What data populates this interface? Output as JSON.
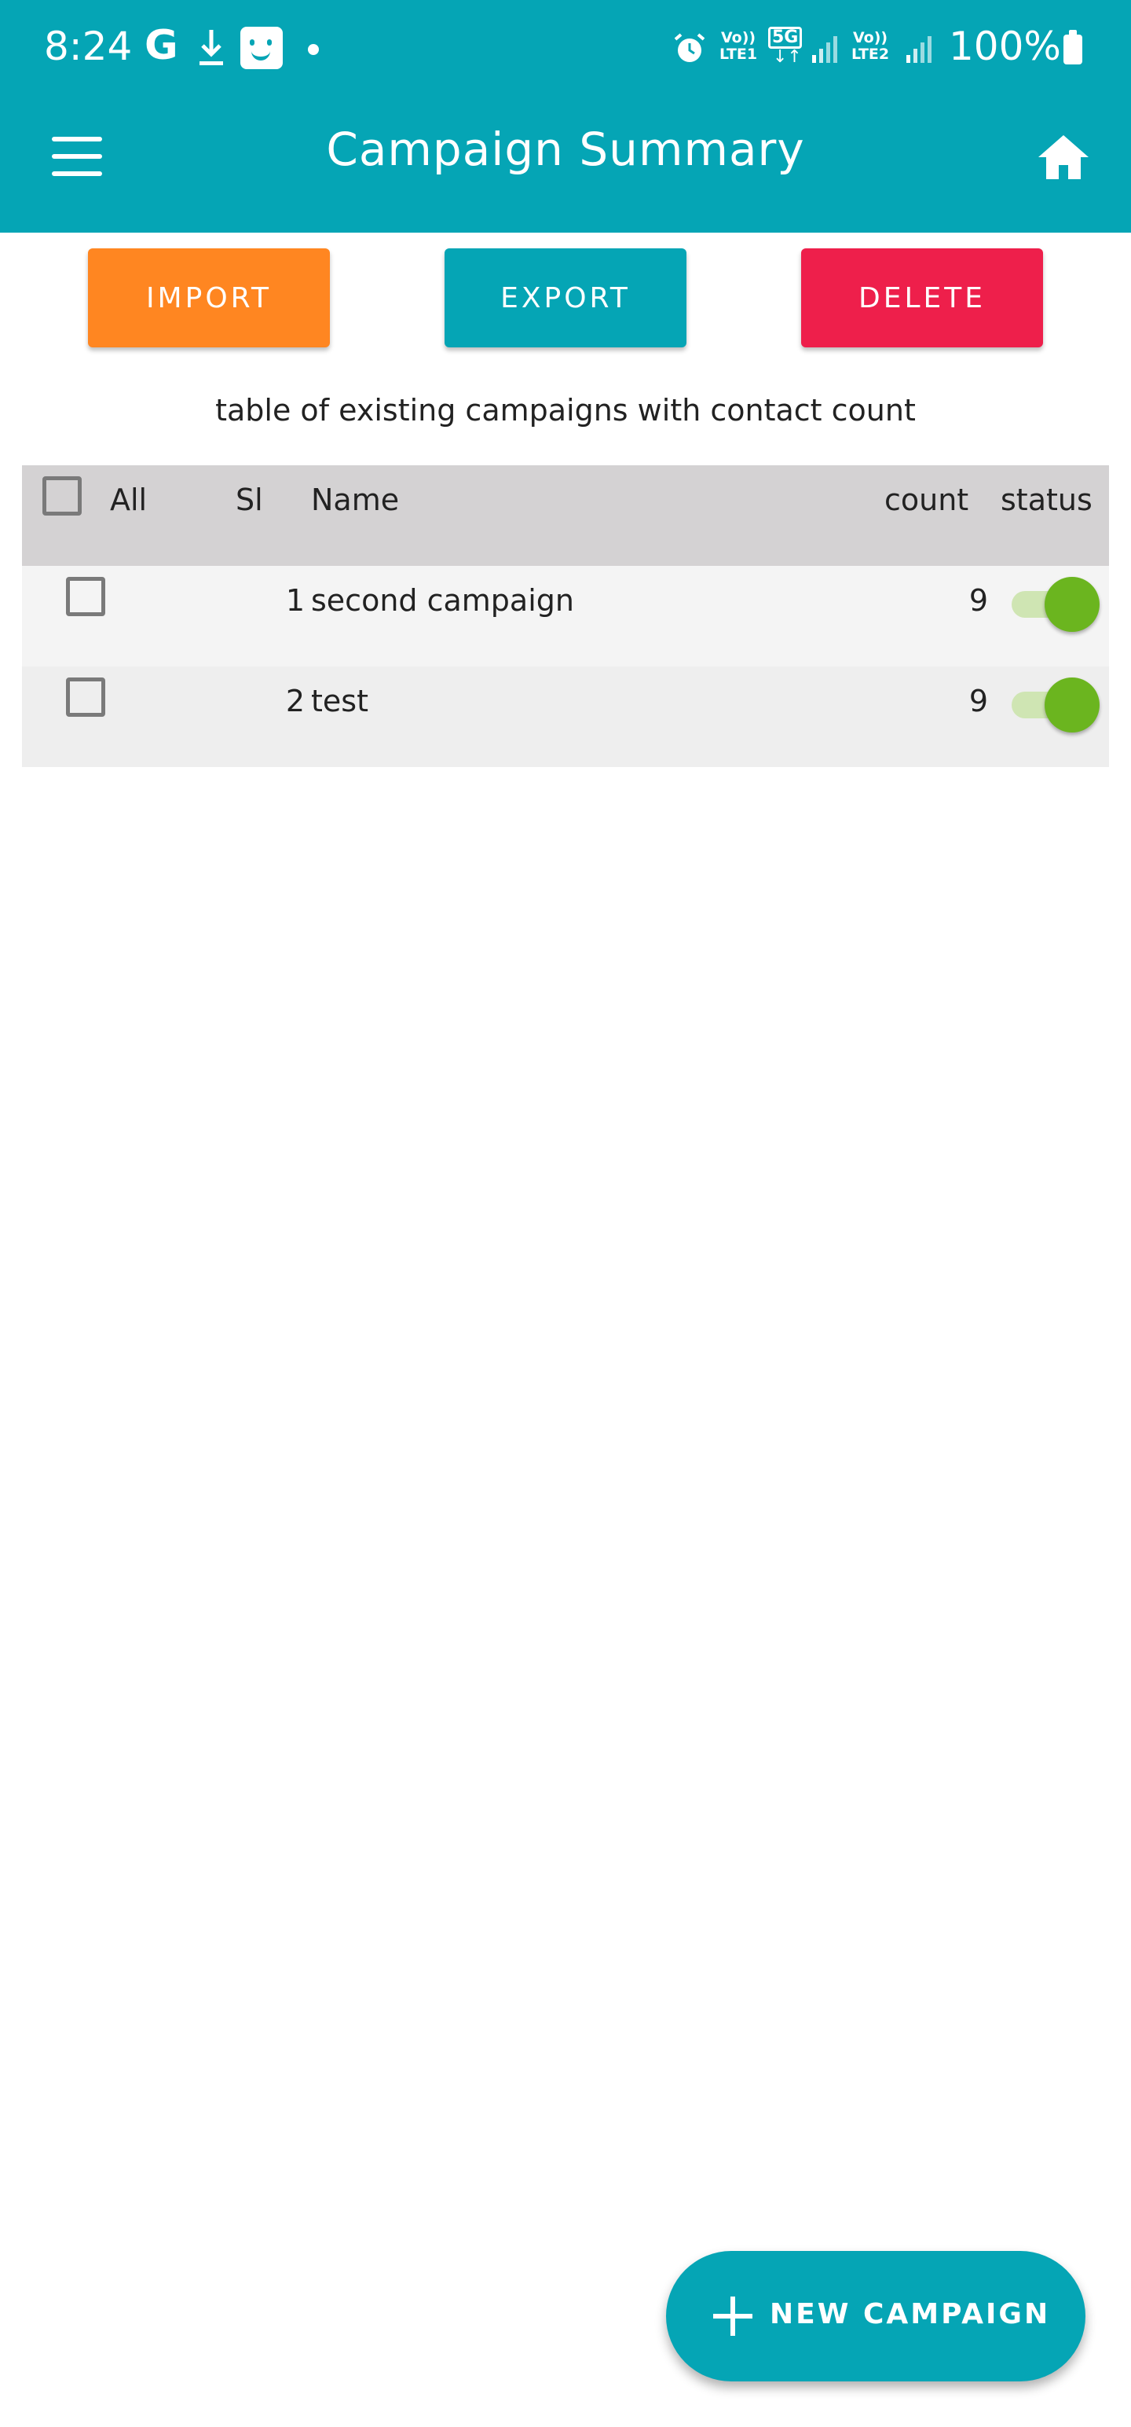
{
  "status_bar": {
    "time": "8:24",
    "g_glyph": "G",
    "net1_top": "Vo))",
    "net1_bottom": "LTE1",
    "five_g": "5G",
    "arrows": "↓↑",
    "net2_top": "Vo))",
    "net2_bottom": "LTE2",
    "battery": "100%"
  },
  "app_bar": {
    "title": "Campaign Summary",
    "menu_icon": "hamburger-menu-icon",
    "home_icon": "home-icon"
  },
  "actions": {
    "import_label": "IMPORT",
    "export_label": "EXPORT",
    "delete_label": "DELETE"
  },
  "caption": "table of existing campaigns with contact count",
  "table": {
    "headers": {
      "all": "All",
      "sl": "Sl",
      "name": "Name",
      "count": "count",
      "status": "status"
    },
    "rows": [
      {
        "sl": "1",
        "name": "second campaign",
        "count": "9",
        "checked": false,
        "status_on": true
      },
      {
        "sl": "2",
        "name": "test",
        "count": "9",
        "checked": false,
        "status_on": true
      }
    ]
  },
  "fab": {
    "label": "NEW CAMPAIGN",
    "icon": "plus-icon"
  },
  "colors": {
    "primary": "#05a5b5",
    "import": "#ff8621",
    "delete": "#ee1f4b",
    "switch_on": "#6bb51f",
    "header_row": "#d4d2d3"
  }
}
